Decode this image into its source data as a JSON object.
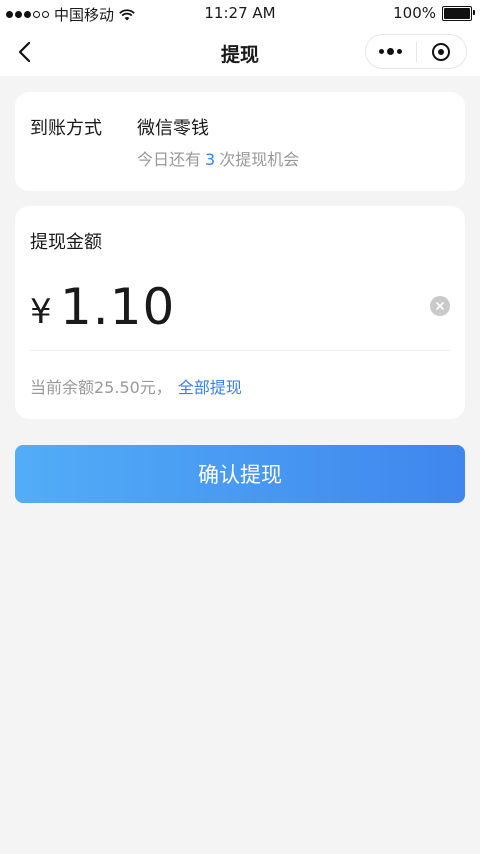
{
  "status_bar": {
    "carrier": "中国移动",
    "time": "11:27 AM",
    "battery": "100%"
  },
  "nav": {
    "title": "提现"
  },
  "method": {
    "label": "到账方式",
    "value": "微信零钱",
    "count_prefix": "今日还有",
    "count": "3",
    "count_suffix": "次提现机会"
  },
  "amount": {
    "label": "提现金额",
    "currency": "¥",
    "value": "1.10",
    "balance_text": "当前余额25.50元，",
    "withdraw_all": "全部提现"
  },
  "confirm": {
    "label": "确认提现"
  },
  "colors": {
    "accent": "#3b7ee8",
    "button_start": "#52adf7",
    "button_end": "#3f86ee",
    "background": "#f4f4f4"
  }
}
